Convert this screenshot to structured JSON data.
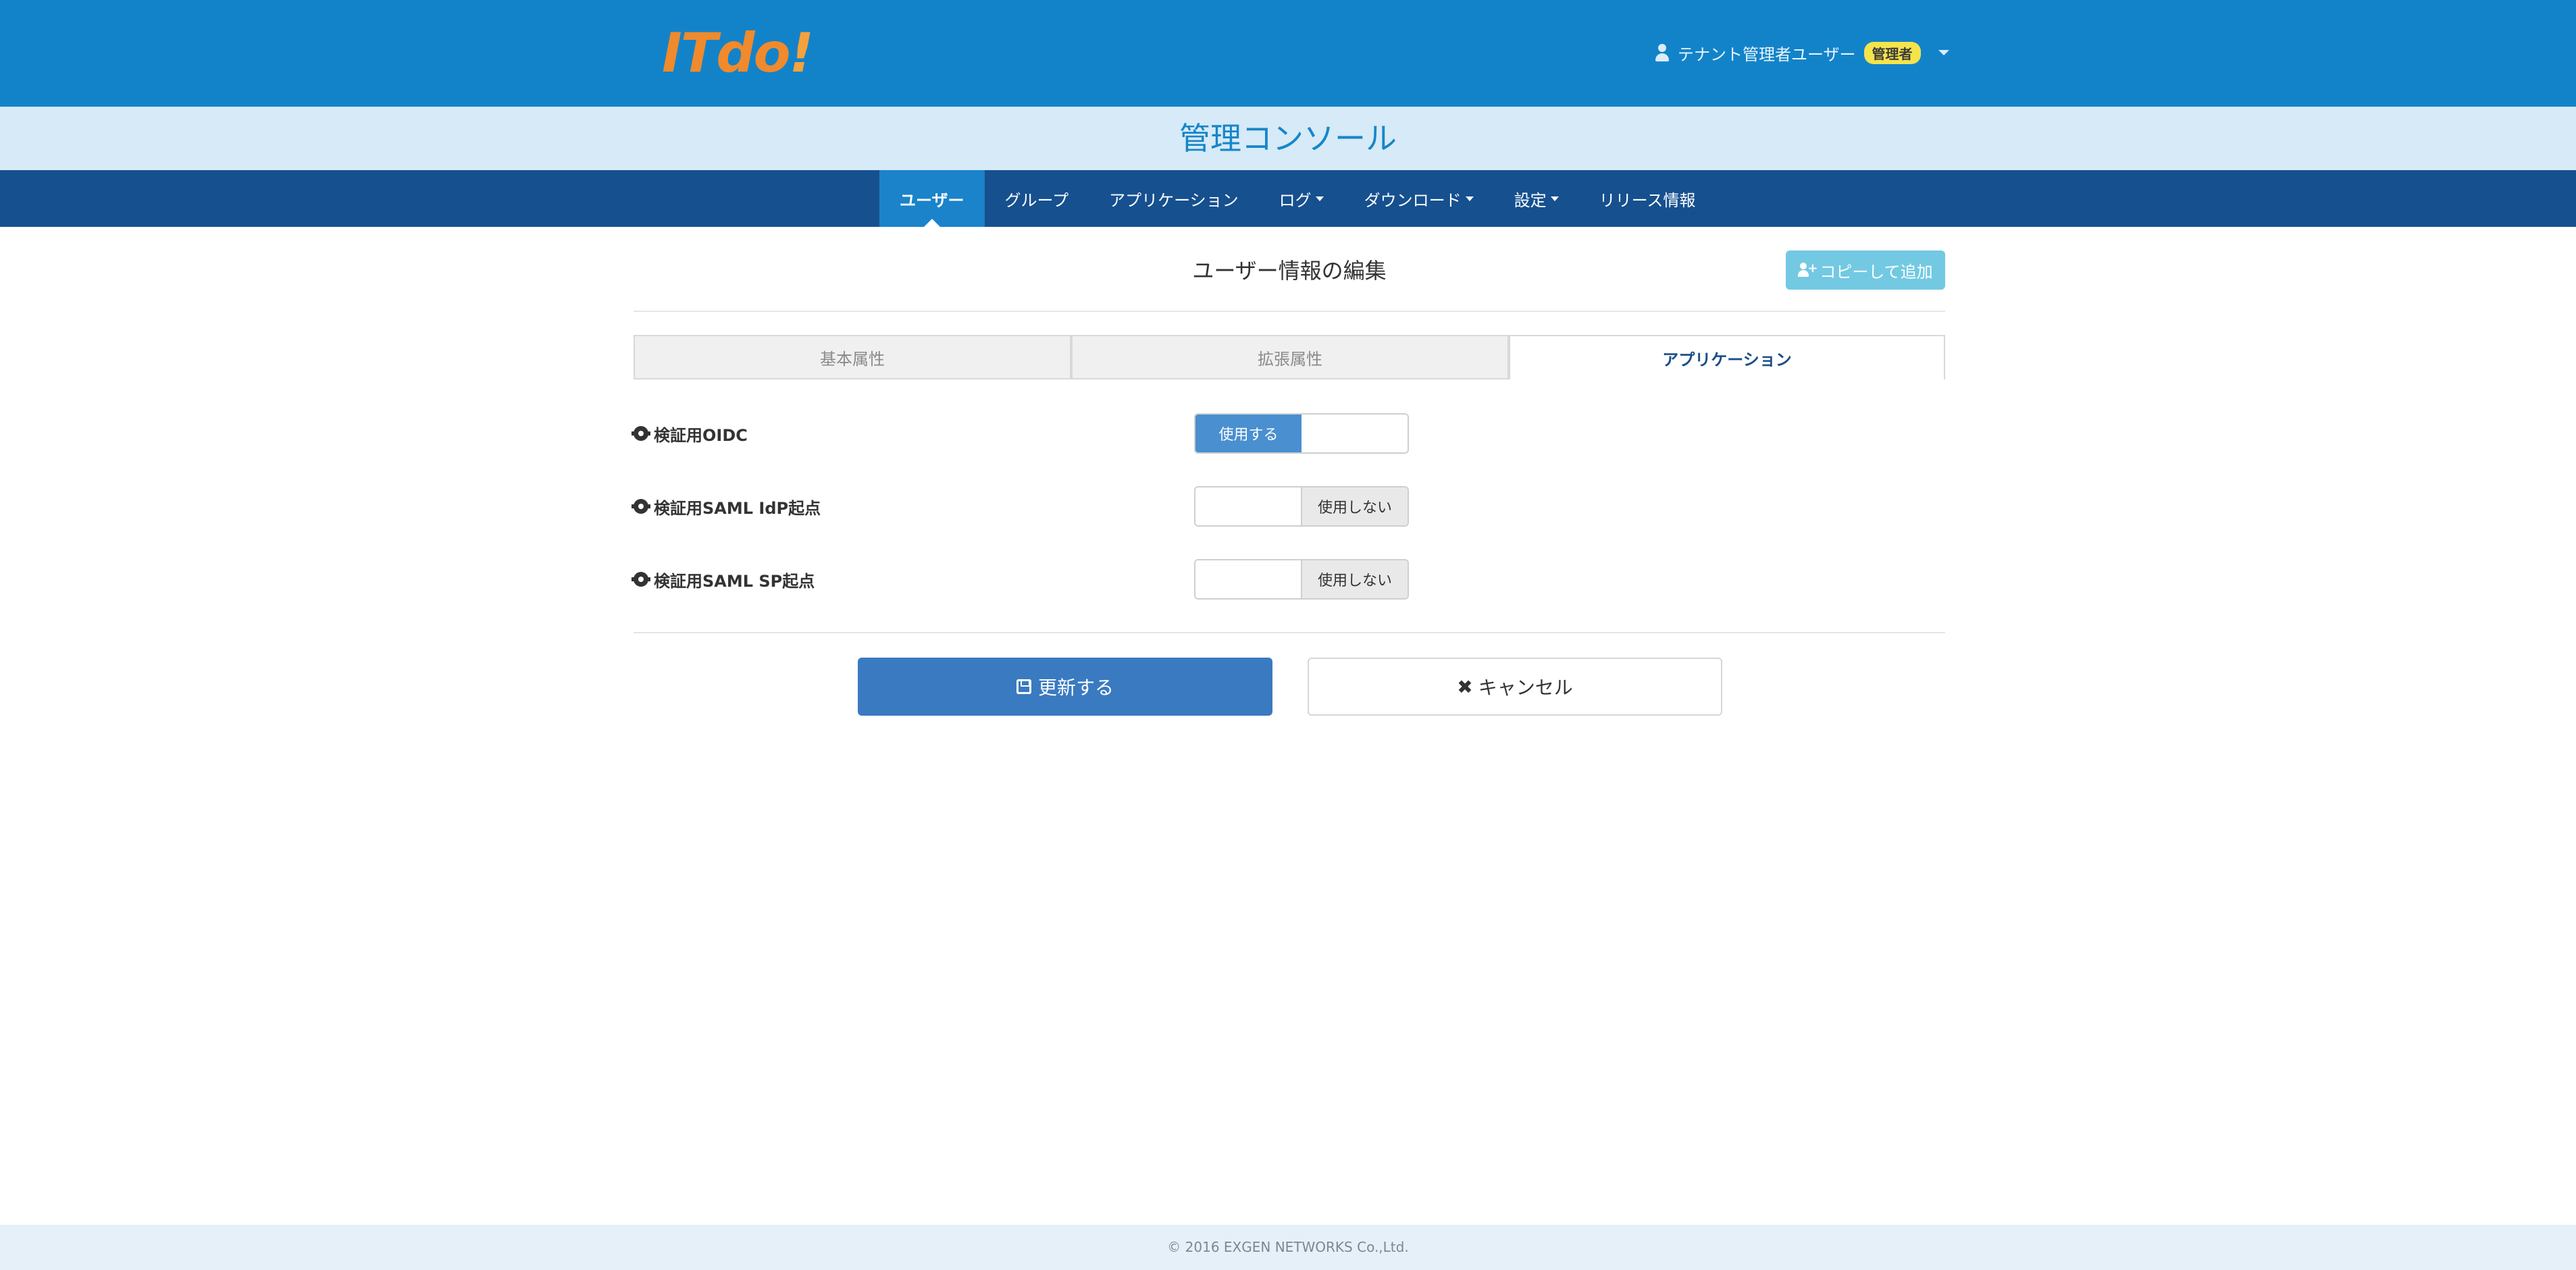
{
  "header": {
    "logo_text": "ITdo",
    "logo_bang": "!",
    "user_name": "テナント管理者ユーザー",
    "role_badge": "管理者"
  },
  "subheader": {
    "title": "管理コンソール"
  },
  "nav": {
    "items": [
      {
        "label": "ユーザー",
        "active": true,
        "dropdown": false
      },
      {
        "label": "グループ",
        "dropdown": false
      },
      {
        "label": "アプリケーション",
        "dropdown": false
      },
      {
        "label": "ログ",
        "dropdown": true
      },
      {
        "label": "ダウンロード",
        "dropdown": true
      },
      {
        "label": "設定",
        "dropdown": true
      },
      {
        "label": "リリース情報",
        "dropdown": false
      }
    ]
  },
  "page": {
    "heading": "ユーザー情報の編集",
    "copy_button": "コピーして追加"
  },
  "tabs": [
    {
      "label": "基本属性",
      "active": false
    },
    {
      "label": "拡張属性",
      "active": false
    },
    {
      "label": "アプリケーション",
      "active": true
    }
  ],
  "applications": [
    {
      "name": "検証用OIDC",
      "state": "使用する"
    },
    {
      "name": "検証用SAML IdP起点",
      "state": "使用しない"
    },
    {
      "name": "検証用SAML SP起点",
      "state": "使用しない"
    }
  ],
  "actions": {
    "update_label": "更新する",
    "cancel_label": "キャンセル"
  },
  "footer": {
    "copyright": "© 2016 EXGEN NETWORKS Co.,Ltd."
  },
  "colors": {
    "header_bg": "#1383c9",
    "subheader_bg": "#d6eaf7",
    "nav_bg": "#16508f",
    "nav_active": "#1a83c9",
    "primary_button": "#3a7ac0",
    "toggle_on": "#4a8fd0",
    "logo": "#f08a2c",
    "badge": "#f4e44b"
  },
  "icons": [
    "user-icon",
    "caret-down-icon",
    "add-user-icon",
    "gear-icon",
    "save-icon",
    "times-icon"
  ]
}
